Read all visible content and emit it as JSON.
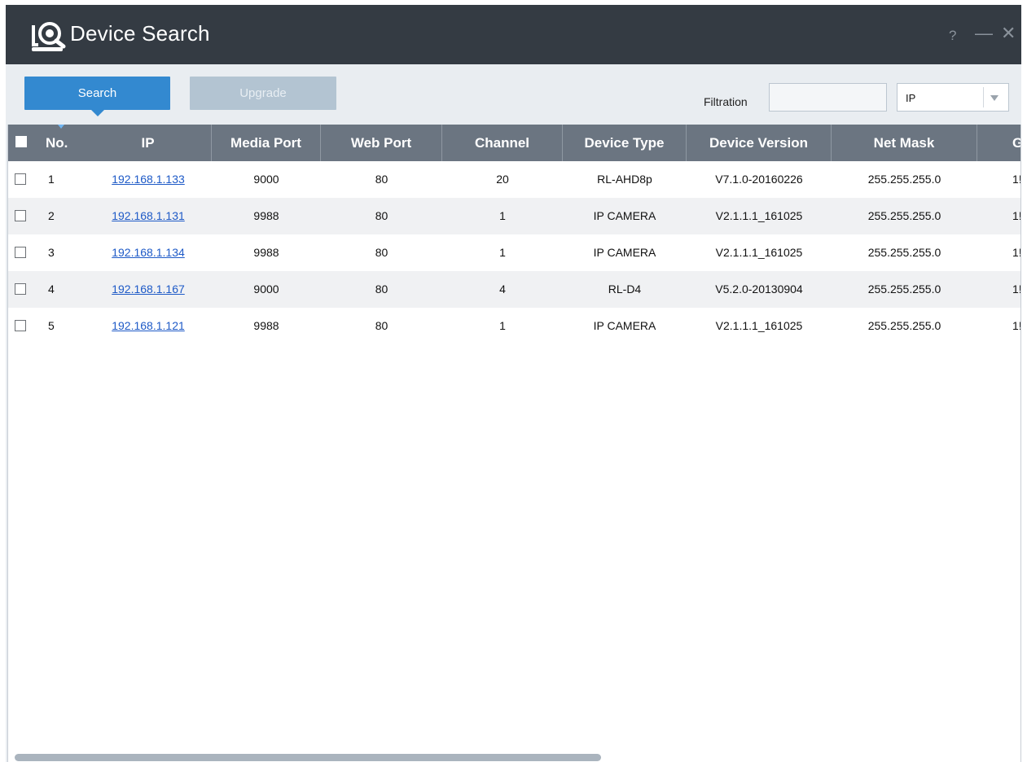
{
  "window": {
    "title": "Device Search",
    "controls": {
      "help": "?",
      "minimize": "—",
      "close": "✕"
    }
  },
  "toolbar": {
    "search_label": "Search",
    "upgrade_label": "Upgrade",
    "filtration_label": "Filtration",
    "filter_value": "",
    "filter_type": "IP"
  },
  "colors": {
    "titlebar": "#343b43",
    "accent": "#3389d0",
    "header": "#6b7581",
    "link": "#1e5ac7"
  },
  "table": {
    "columns": [
      "No.",
      "IP",
      "Media Port",
      "Web Port",
      "Channel",
      "Device Type",
      "Device Version",
      "Net Mask",
      "G"
    ],
    "rows": [
      {
        "no": "1",
        "ip": "192.168.1.133",
        "media_port": "9000",
        "web_port": "80",
        "channel": "20",
        "device_type": "RL-AHD8p",
        "device_version": "V7.1.0-20160226",
        "net_mask": "255.255.255.0",
        "gateway": "1!"
      },
      {
        "no": "2",
        "ip": "192.168.1.131",
        "media_port": "9988",
        "web_port": "80",
        "channel": "1",
        "device_type": "IP CAMERA",
        "device_version": "V2.1.1.1_161025",
        "net_mask": "255.255.255.0",
        "gateway": "1!"
      },
      {
        "no": "3",
        "ip": "192.168.1.134",
        "media_port": "9988",
        "web_port": "80",
        "channel": "1",
        "device_type": "IP CAMERA",
        "device_version": "V2.1.1.1_161025",
        "net_mask": "255.255.255.0",
        "gateway": "1!"
      },
      {
        "no": "4",
        "ip": "192.168.1.167",
        "media_port": "9000",
        "web_port": "80",
        "channel": "4",
        "device_type": "RL-D4",
        "device_version": "V5.2.0-20130904",
        "net_mask": "255.255.255.0",
        "gateway": "1!"
      },
      {
        "no": "5",
        "ip": "192.168.1.121",
        "media_port": "9988",
        "web_port": "80",
        "channel": "1",
        "device_type": "IP CAMERA",
        "device_version": "V2.1.1.1_161025",
        "net_mask": "255.255.255.0",
        "gateway": "1!"
      }
    ]
  }
}
